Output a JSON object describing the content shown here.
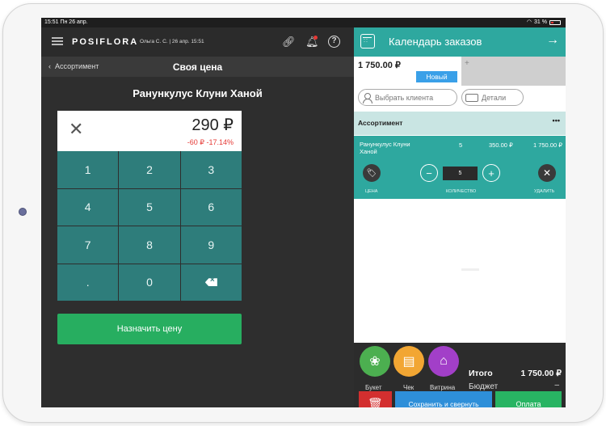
{
  "statusbar": {
    "time_date": "15:51  Пн 26 апр.",
    "battery": "31 %"
  },
  "header": {
    "logo": "POSIFLORA",
    "operator": "Ольга С. С. | 26 апр. 15:51"
  },
  "price_screen": {
    "back_label": "Ассортимент",
    "title": "Своя цена",
    "product_name": "Ранункулус Клуни Ханой",
    "price_value": "290 ₽",
    "price_diff": "-60 ₽  -17.14%",
    "keypad": [
      "1",
      "2",
      "3",
      "4",
      "5",
      "6",
      "7",
      "8",
      "9",
      ".",
      "0"
    ],
    "assign_label": "Назначить цену"
  },
  "orders": {
    "title": "Календарь заказов",
    "order_total": "1 750.00 ₽",
    "new_badge": "Новый",
    "add_tab": "+",
    "client_label": "Выбрать клиента",
    "details_label": "Детали",
    "assortment_title": "Ассортимент",
    "menu_dots": "•••",
    "item": {
      "name": "Ранункулус Клуни Ханой",
      "qty": "5",
      "price": "350.00 ₽",
      "sum": "1 750.00 ₽",
      "qty_input": "5",
      "caption_price": "ЦЕНА",
      "caption_qty": "КОЛИЧЕСТВО",
      "caption_remove": "УДАЛИТЬ"
    },
    "bottom": {
      "bouquet_label": "Букет",
      "check_label": "Чек",
      "vitrina_label": "Витрина",
      "total_label": "Итого",
      "total_value": "1 750.00 ₽",
      "budget_label": "Бюджет",
      "budget_value": "–",
      "save_label": "Сохранить и свернуть",
      "pay_label": "Оплата"
    }
  },
  "colors": {
    "accent": "#2ea89f",
    "keypad": "#2e7d7b",
    "green": "#27ae60",
    "danger": "#e53935",
    "blue": "#2e8fd9"
  }
}
